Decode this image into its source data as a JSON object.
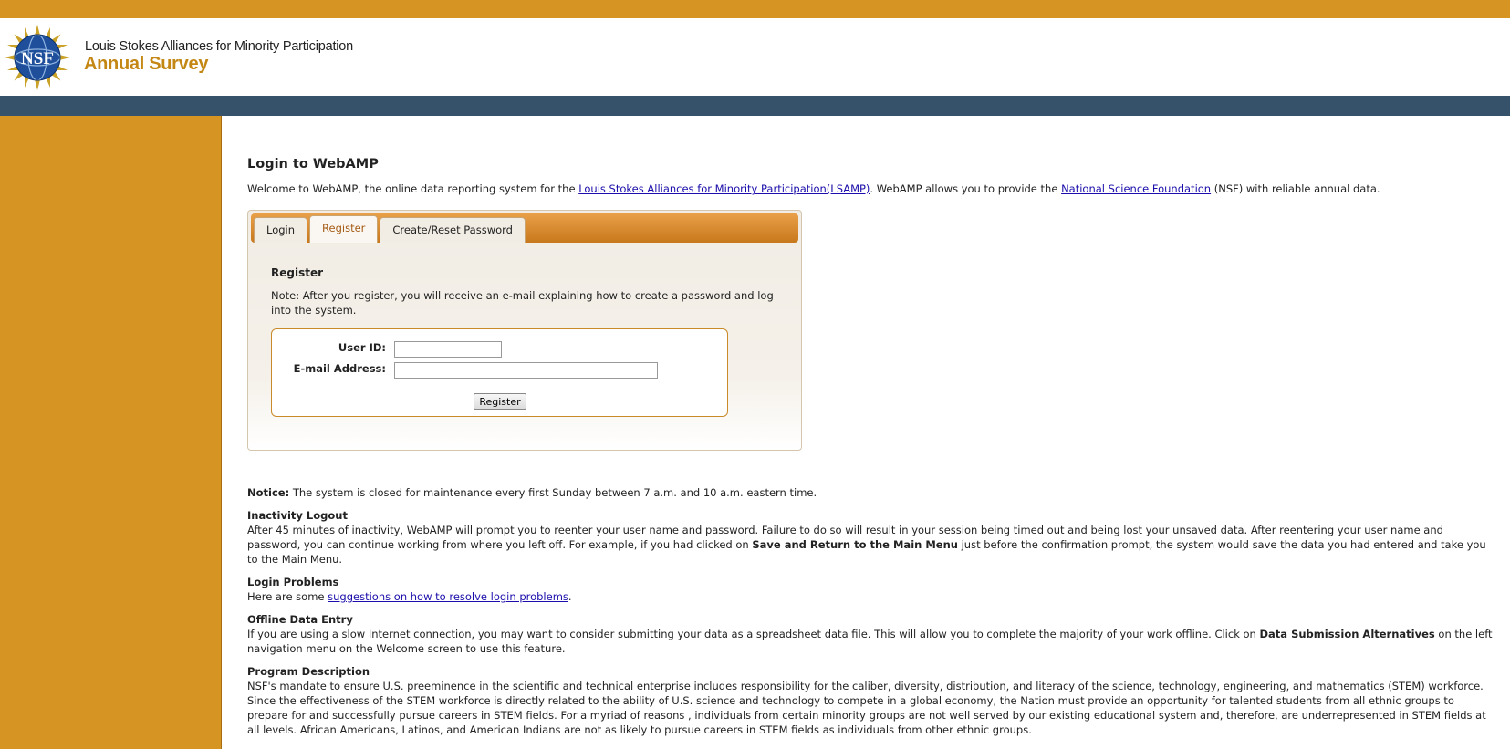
{
  "header": {
    "program_name": "Louis Stokes Alliances for Minority Participation",
    "survey_name": "Annual Survey",
    "logo_text": "NSF"
  },
  "main": {
    "title": "Login to WebAMP",
    "intro": {
      "before_link1": "Welcome to WebAMP, the online data reporting system for the ",
      "link1": "Louis Stokes Alliances for Minority Participation(LSAMP)",
      "between": ". WebAMP allows you to provide the ",
      "link2": "National Science Foundation",
      "after": " (NSF) with reliable annual data."
    },
    "tabs": [
      {
        "label": "Login"
      },
      {
        "label": "Register"
      },
      {
        "label": "Create/Reset Password"
      }
    ],
    "active_tab": "Register",
    "register": {
      "heading": "Register",
      "note": "Note: After you register, you will receive an e-mail explaining how to create a password and log into the system.",
      "userid_label": "User ID:",
      "userid_value": "",
      "email_label": "E-mail Address:",
      "email_value": "",
      "button": "Register"
    },
    "notice": {
      "label": "Notice:",
      "text": " The system is closed for maintenance every first Sunday between 7 a.m. and 10 a.m. eastern time."
    },
    "inactivity": {
      "heading": "Inactivity Logout",
      "text1": "After 45 minutes of inactivity, WebAMP will prompt you to reenter your user name and password. Failure to do so will result in your session being timed out and being lost your unsaved data. After reentering your user name and password, you can continue working from where you left off. For example, if you had clicked on ",
      "bold": "Save and Return to the Main Menu",
      "text2": " just before the confirmation prompt, the system would save the data you had entered and take you to the Main Menu."
    },
    "login_problems": {
      "heading": "Login Problems",
      "before": "Here are some ",
      "link": "suggestions on how to resolve login problems",
      "after": "."
    },
    "offline": {
      "heading": "Offline Data Entry",
      "text1": "If you are using a slow Internet connection, you may want to consider submitting your data as a spreadsheet data file. This will allow you to complete the majority of your work offline. Click on ",
      "bold": "Data Submission Alternatives",
      "text2": " on the left navigation menu on the Welcome screen to use this feature."
    },
    "program": {
      "heading": "Program Description",
      "text": "NSF's mandate to ensure U.S. preeminence in the scientific and technical enterprise includes responsibility for the caliber, diversity, distribution, and literacy of the science, technology, engineering, and mathematics (STEM) workforce. Since the effectiveness of the STEM workforce is directly related to the ability of U.S. science and technology to compete in a global economy, the Nation must provide an opportunity for talented students from all ethnic groups to prepare for and successfully pursue careers in STEM fields. For a myriad of reasons , individuals from certain minority groups are not well served by our existing educational system and, therefore, are underrepresented in STEM fields at all levels. African Americans, Latinos, and American Indians are not as likely to pursue careers in STEM fields as individuals from other ethnic groups."
    }
  },
  "colors": {
    "accent_gold": "#D69423",
    "nav_slate": "#36526A",
    "survey_text": "#C48714"
  },
  "icons": {
    "logo": "nsf-logo-icon"
  }
}
